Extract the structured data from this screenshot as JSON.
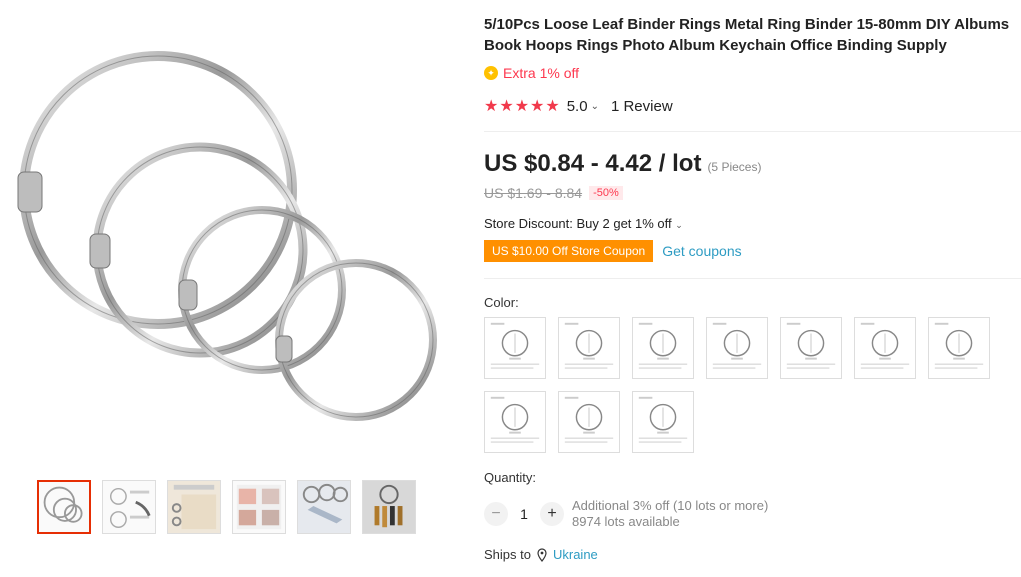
{
  "product": {
    "title": "5/10Pcs Loose Leaf Binder Rings Metal Ring Binder 15-80mm DIY Albums Book Hoops Rings Photo Album Keychain Office Binding Supply",
    "extra_discount": "Extra 1% off",
    "rating_stars": "★★★★★",
    "rating_score": "5.0",
    "rating_chevron": "⌄",
    "reviews": "1 Review",
    "price": "US $0.84 - 4.42 / lot",
    "pieces": "(5 Pieces)",
    "old_price": "US $1.69 - 8.84",
    "discount_badge": "-50%",
    "store_discount": "Store Discount: Buy 2 get 1% off",
    "store_discount_chevron": "⌄",
    "coupon": "US $10.00 Off Store Coupon",
    "get_coupons": "Get coupons"
  },
  "color": {
    "label": "Color:",
    "swatch_count": 10
  },
  "quantity": {
    "label": "Quantity:",
    "minus": "−",
    "value": "1",
    "plus": "+",
    "additional": "Additional 3% off (10 lots or more)",
    "available": "8974 lots available"
  },
  "shipping": {
    "label": "Ships to",
    "country": "Ukraine"
  },
  "gallery": {
    "thumbnail_count": 6,
    "active_thumbnail": 0
  },
  "colors": {
    "accent_red": "#fd384f",
    "star_red": "#f1394b",
    "coupon_orange": "#ff9000",
    "link_blue": "#2e9cc3",
    "active_border": "#e62e04"
  },
  "icons": {
    "coin": "coin-icon",
    "location": "location-pin-icon"
  }
}
